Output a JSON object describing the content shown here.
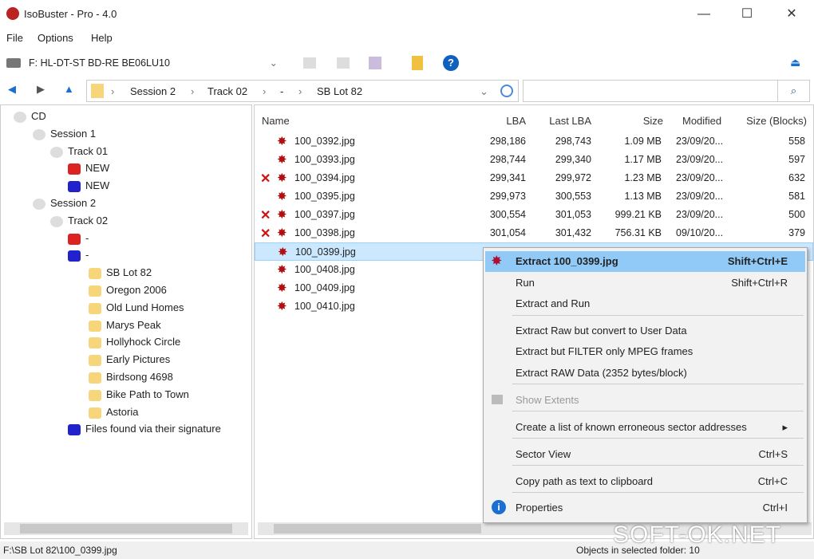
{
  "window": {
    "title": "IsoBuster - Pro - 4.0",
    "minimize": "—",
    "maximize": "☐",
    "close": "✕"
  },
  "menu": [
    "File",
    "Options",
    "Help"
  ],
  "toolbar": {
    "drive": "F: HL-DT-ST  BD-RE  BE06LU10"
  },
  "nav": {
    "path": [
      "Session 2",
      "Track 02",
      "-",
      "SB Lot 82"
    ],
    "search_placeholder": ""
  },
  "tree": [
    {
      "label": "CD",
      "level": 0,
      "icon": "disc"
    },
    {
      "label": "Session 1",
      "level": 1,
      "icon": "disc"
    },
    {
      "label": "Track 01",
      "level": 2,
      "icon": "disc"
    },
    {
      "label": "NEW",
      "level": 3,
      "icon": "red-fs"
    },
    {
      "label": "NEW",
      "level": 3,
      "icon": "blue-fs"
    },
    {
      "label": "Session 2",
      "level": 1,
      "icon": "disc"
    },
    {
      "label": "Track 02",
      "level": 2,
      "icon": "disc"
    },
    {
      "label": "-",
      "level": 3,
      "icon": "red-fs"
    },
    {
      "label": "-",
      "level": 3,
      "icon": "blue-fs"
    },
    {
      "label": "SB Lot 82",
      "level": 4,
      "icon": "folder"
    },
    {
      "label": "Oregon 2006",
      "level": 4,
      "icon": "folder"
    },
    {
      "label": "Old Lund Homes",
      "level": 4,
      "icon": "folder"
    },
    {
      "label": "Marys Peak",
      "level": 4,
      "icon": "folder"
    },
    {
      "label": "Hollyhock Circle",
      "level": 4,
      "icon": "folder"
    },
    {
      "label": "Early Pictures",
      "level": 4,
      "icon": "folder"
    },
    {
      "label": "Birdsong 4698",
      "level": 4,
      "icon": "folder"
    },
    {
      "label": "Bike Path to Town",
      "level": 4,
      "icon": "folder"
    },
    {
      "label": "Astoria",
      "level": 4,
      "icon": "folder"
    },
    {
      "label": "Files found via their signature",
      "level": 3,
      "icon": "blue-fs"
    }
  ],
  "columns": [
    "Name",
    "LBA",
    "Last LBA",
    "Size",
    "Modified",
    "Size (Blocks)"
  ],
  "files": [
    {
      "name": "100_0392.jpg",
      "lba": "298,186",
      "last": "298,743",
      "size": "1.09 MB",
      "mod": "23/09/20...",
      "blocks": "558",
      "err": false
    },
    {
      "name": "100_0393.jpg",
      "lba": "298,744",
      "last": "299,340",
      "size": "1.17 MB",
      "mod": "23/09/20...",
      "blocks": "597",
      "err": false
    },
    {
      "name": "100_0394.jpg",
      "lba": "299,341",
      "last": "299,972",
      "size": "1.23 MB",
      "mod": "23/09/20...",
      "blocks": "632",
      "err": true
    },
    {
      "name": "100_0395.jpg",
      "lba": "299,973",
      "last": "300,553",
      "size": "1.13 MB",
      "mod": "23/09/20...",
      "blocks": "581",
      "err": false
    },
    {
      "name": "100_0397.jpg",
      "lba": "300,554",
      "last": "301,053",
      "size": "999.21 KB",
      "mod": "23/09/20...",
      "blocks": "500",
      "err": true
    },
    {
      "name": "100_0398.jpg",
      "lba": "301,054",
      "last": "301,432",
      "size": "756.31 KB",
      "mod": "09/10/20...",
      "blocks": "379",
      "err": true
    },
    {
      "name": "100_0399.jpg",
      "lba": "",
      "last": "",
      "size": "",
      "mod": "",
      "blocks": "",
      "err": false,
      "selected": true
    },
    {
      "name": "100_0408.jpg",
      "lba": "",
      "last": "",
      "size": "",
      "mod": "",
      "blocks": "",
      "err": false
    },
    {
      "name": "100_0409.jpg",
      "lba": "",
      "last": "",
      "size": "",
      "mod": "",
      "blocks": "",
      "err": false
    },
    {
      "name": "100_0410.jpg",
      "lba": "",
      "last": "",
      "size": "",
      "mod": "",
      "blocks": "",
      "err": false
    }
  ],
  "context_menu": [
    {
      "label": "Extract 100_0399.jpg",
      "shortcut": "Shift+Ctrl+E",
      "bold": true,
      "highlight": true
    },
    {
      "label": "Run",
      "shortcut": "Shift+Ctrl+R"
    },
    {
      "label": "Extract and Run",
      "shortcut": ""
    },
    {
      "sep": true
    },
    {
      "label": "Extract Raw but convert to User Data",
      "shortcut": ""
    },
    {
      "label": "Extract but FILTER only MPEG frames",
      "shortcut": ""
    },
    {
      "label": "Extract RAW Data (2352 bytes/block)",
      "shortcut": ""
    },
    {
      "sep": true
    },
    {
      "label": "Show Extents",
      "shortcut": "",
      "disabled": true
    },
    {
      "sep": true
    },
    {
      "label": "Create a list of known erroneous sector addresses",
      "shortcut": "▸"
    },
    {
      "sep": true
    },
    {
      "label": "Sector View",
      "shortcut": "Ctrl+S"
    },
    {
      "sep": true
    },
    {
      "label": "Copy path as text to clipboard",
      "shortcut": "Ctrl+C"
    },
    {
      "sep": true
    },
    {
      "label": "Properties",
      "shortcut": "Ctrl+I"
    }
  ],
  "status": {
    "path": "F:\\SB Lot 82\\100_0399.jpg",
    "objects": "Objects in selected folder: 10"
  },
  "watermark": "SOFT-OK.NET"
}
